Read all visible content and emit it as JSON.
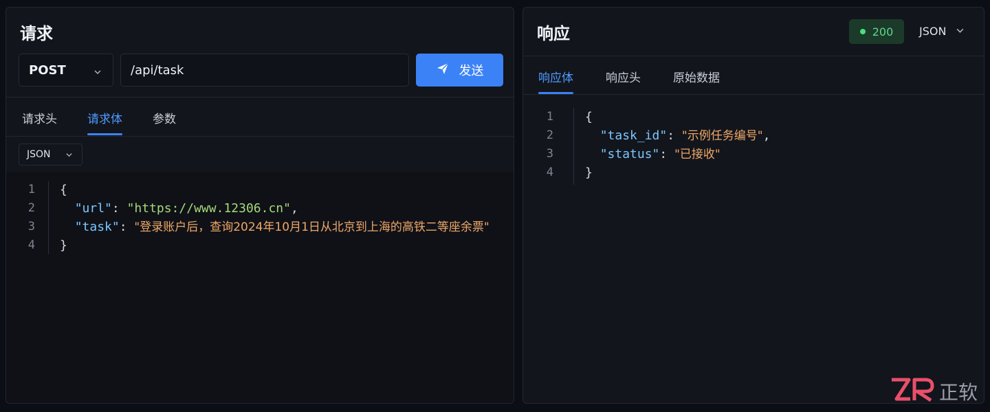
{
  "request": {
    "title": "请求",
    "method": "POST",
    "url": "/api/task",
    "send_label": "发送",
    "tabs": [
      {
        "label": "请求头",
        "active": false
      },
      {
        "label": "请求体",
        "active": true
      },
      {
        "label": "参数",
        "active": false
      }
    ],
    "format": "JSON",
    "line_numbers": [
      "1",
      "2",
      "3",
      "4"
    ],
    "code": {
      "open": "{",
      "url_key": "\"url\"",
      "url_value": "\"https://www.12306.cn\"",
      "task_key": "\"task\"",
      "task_value": "\"登录账户后，查询2024年10月1日从北京到上海的高铁二等座余票\"",
      "close": "}"
    }
  },
  "response": {
    "title": "响应",
    "status_code": "200",
    "format": "JSON",
    "tabs": [
      {
        "label": "响应体",
        "active": true
      },
      {
        "label": "响应头",
        "active": false
      },
      {
        "label": "原始数据",
        "active": false
      }
    ],
    "line_numbers": [
      "1",
      "2",
      "3",
      "4"
    ],
    "code": {
      "open": "{",
      "task_id_key": "\"task_id\"",
      "task_id_value": "\"示例任务编号\"",
      "status_key": "\"status\"",
      "status_value": "\"已接收\"",
      "close": "}"
    }
  },
  "watermark": {
    "text": "正软"
  },
  "colors": {
    "accent": "#3b82f6",
    "status_green": "#4ade80",
    "json_key": "#7cc7ff",
    "json_string_url": "#a6d97a",
    "json_string": "#f0a868"
  },
  "icons": {
    "send": "paper-plane-icon",
    "dropdown": "chevron-down-icon",
    "status": "status-dot-icon",
    "logo": "zr-logo-icon"
  }
}
